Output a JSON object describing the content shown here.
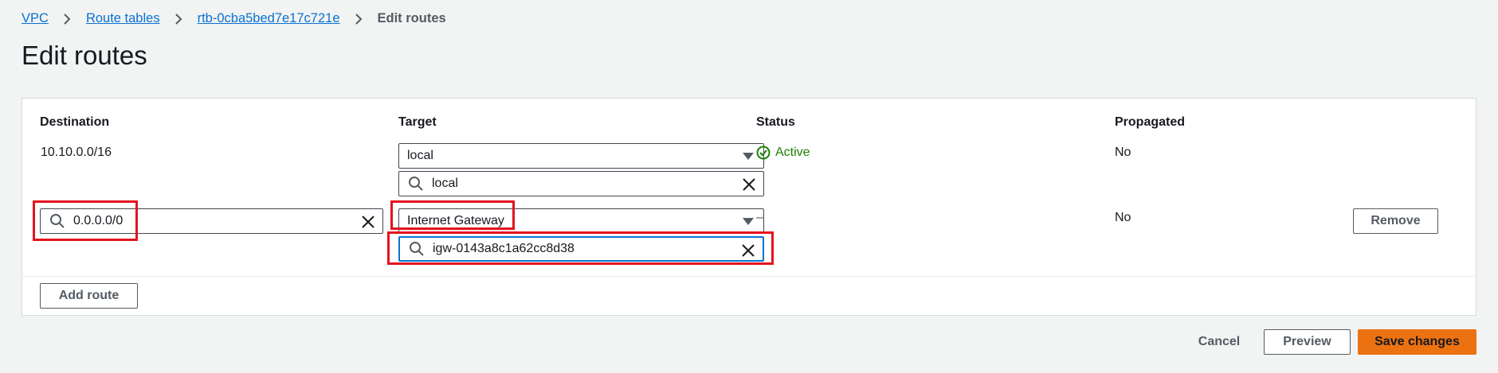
{
  "breadcrumb": {
    "items": [
      {
        "label": "VPC"
      },
      {
        "label": "Route tables"
      },
      {
        "label": "rtb-0cba5bed7e17c721e"
      }
    ],
    "current": "Edit routes"
  },
  "page": {
    "title": "Edit routes"
  },
  "table": {
    "headers": {
      "destination": "Destination",
      "target": "Target",
      "status": "Status",
      "propagated": "Propagated"
    },
    "rows": [
      {
        "destination": "10.10.0.0/16",
        "target_selected": "local",
        "target_search": "local",
        "status": "Active",
        "propagated": "No"
      },
      {
        "destination_search": "0.0.0.0/0",
        "target_selected": "Internet Gateway",
        "target_search": "igw-0143a8c1a62cc8d38",
        "status": "–",
        "propagated": "No",
        "remove_label": "Remove"
      }
    ],
    "add_route_label": "Add route"
  },
  "footer": {
    "cancel_label": "Cancel",
    "preview_label": "Preview",
    "save_label": "Save changes"
  },
  "colors": {
    "link": "#0972d3",
    "success": "#1d8102",
    "primary": "#ec7211",
    "highlight": "#e3141e"
  }
}
